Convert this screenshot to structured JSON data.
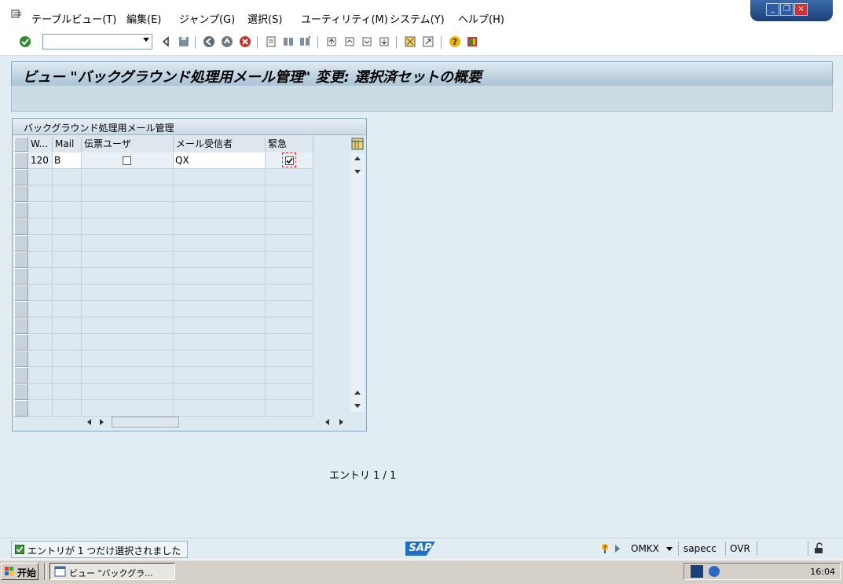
{
  "menu": {
    "items": [
      "テーブルビュー(T)",
      "編集(E)",
      "ジャンプ(G)",
      "選択(S)",
      "ユーティリティ(M)",
      "システム(Y)",
      "ヘルプ(H)"
    ]
  },
  "window_controls": {
    "minimize": "_",
    "restore": "❐",
    "close": "×"
  },
  "toolbar": {
    "command_field_value": ""
  },
  "page": {
    "title": "ビュー \"バックグラウンド処理用メール管理\" 変更: 選択済セットの概要"
  },
  "table": {
    "title": "バックグラウンド処理用メール管理",
    "columns": [
      "W...",
      "Mail",
      "伝票ユーザ",
      "メール受信者",
      "緊急"
    ],
    "rows": [
      {
        "w": "120",
        "mail": "B",
        "doc_user_checked": false,
        "recipient": "QX",
        "urgent_checked": true
      }
    ],
    "empty_rows": 15
  },
  "entry": {
    "text": "エントリ 1 / 1"
  },
  "status": {
    "message": "エントリが 1 つだけ選択されました",
    "logo": "SAP",
    "transaction": "OMKX",
    "server": "sapecc",
    "mode": "OVR"
  },
  "taskbar": {
    "start_label": "开始",
    "task_label": "ビュー \"バックグラ...",
    "clock": "16:04"
  },
  "colors": {
    "accent": "#1f6fc4",
    "background": "#e2edf3",
    "title_gradient_end": "#a9c3d6"
  }
}
